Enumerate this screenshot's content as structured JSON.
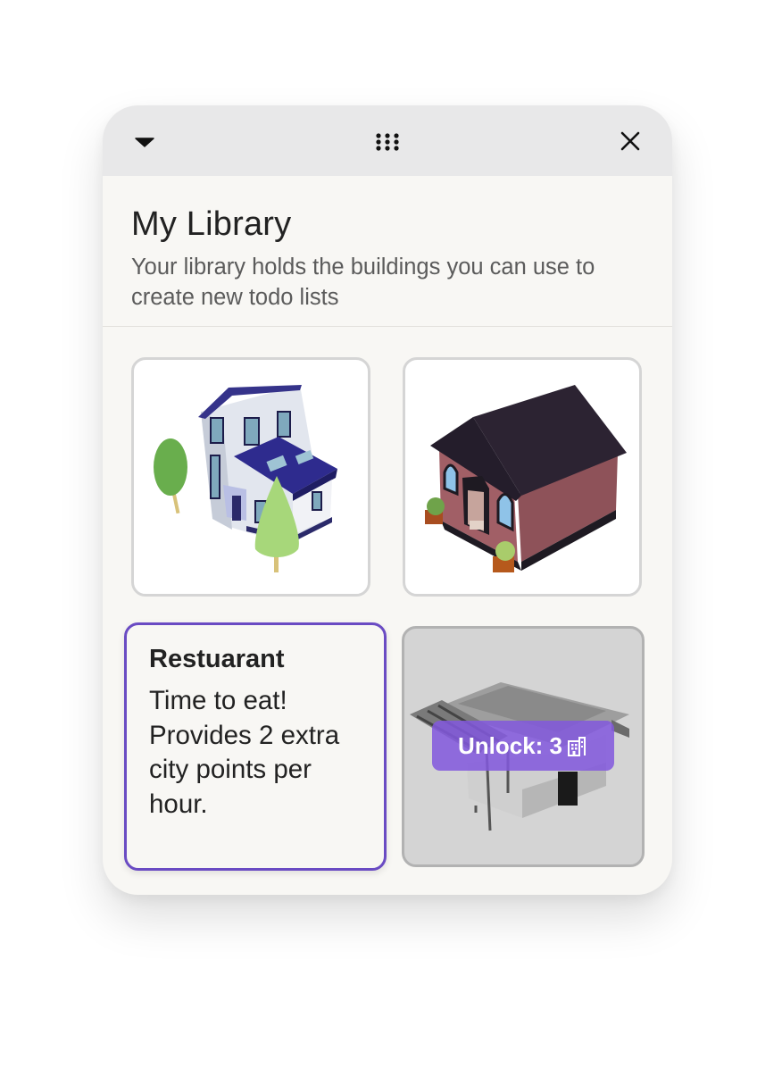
{
  "toolbar": {
    "collapse_icon": "caret-down-icon",
    "drag_icon": "drag-grid-icon",
    "close_icon": "close-icon"
  },
  "header": {
    "title": "My Library",
    "subtitle": "Your library holds the buildings you can use to create new todo lists"
  },
  "library": {
    "items": [
      {
        "kind": "building",
        "icon": "townhouse-illustration",
        "locked": false
      },
      {
        "kind": "building",
        "icon": "cottage-illustration",
        "locked": false
      },
      {
        "kind": "info",
        "title": "Restuarant",
        "description": "Time to eat! Provides 2 extra city points per hour.",
        "selected": true
      },
      {
        "kind": "building",
        "icon": "restaurant-illustration",
        "locked": true,
        "unlock_label": "Unlock: 3",
        "unlock_icon": "city-building-icon"
      }
    ]
  },
  "colors": {
    "accent": "#6a4bc3",
    "unlock_badge": "#8258dd",
    "panel_bg": "#f8f7f4",
    "topbar_bg": "#e8e8e9"
  }
}
